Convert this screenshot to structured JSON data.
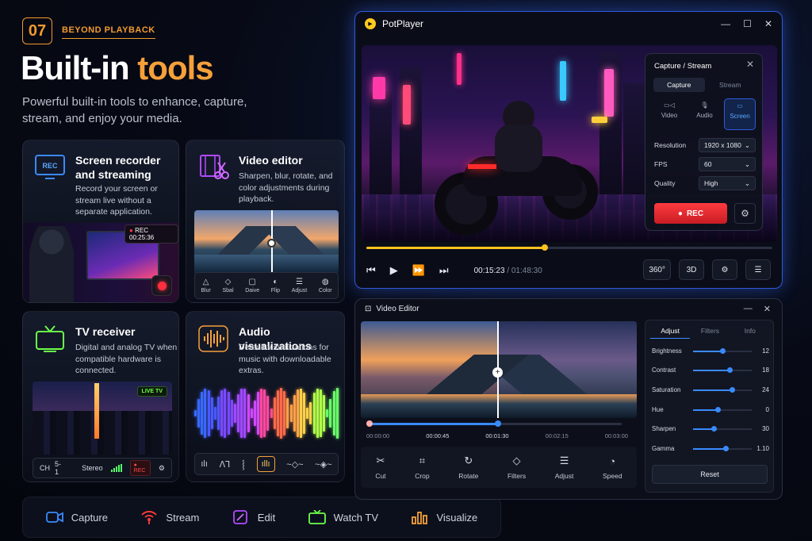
{
  "header": {
    "number": "07",
    "kicker": "BEYOND PLAYBACK",
    "title_main": "Built-in",
    "title_accent": "tools",
    "subtitle": "Powerful built-in tools to enhance, capture, stream, and enjoy your media."
  },
  "cards": {
    "recorder": {
      "icon_label": "REC",
      "title": "Screen recorder and streaming",
      "desc": "Record your screen or stream live without a separate application.",
      "badge": "REC 00:25:36"
    },
    "editor": {
      "title": "Video editor",
      "desc": "Sharpen, blur, rotate, and color adjustments during playback.",
      "tools": [
        "Blur",
        "Sbal",
        "Daive",
        "Flip",
        "Adjust",
        "Color"
      ]
    },
    "tv": {
      "title": "TV receiver",
      "desc": "Digital and analog TV when compatible hardware is connected.",
      "live": "LIVE TV",
      "channel": "CH",
      "channel_num": "5-1",
      "audio": "Stereo",
      "rec": "REC"
    },
    "audio": {
      "title": "Audio visualizations",
      "desc": "Default visualizations for music with downloadable extras."
    }
  },
  "bottom_bar": [
    {
      "label": "Capture",
      "icon": "camera-icon",
      "color": "#3a8aff"
    },
    {
      "label": "Stream",
      "icon": "broadcast-icon",
      "color": "#ff3b3b"
    },
    {
      "label": "Edit",
      "icon": "magic-wand-icon",
      "color": "#b04aff"
    },
    {
      "label": "Watch TV",
      "icon": "tv-icon",
      "color": "#6cff4a"
    },
    {
      "label": "Visualize",
      "icon": "bars-icon",
      "color": "#f5a03a"
    }
  ],
  "player": {
    "title": "PotPlayer",
    "window_controls": [
      "—",
      "☐",
      "✕"
    ],
    "progress": 0.44,
    "time_current": "00:15:23",
    "time_total": "/ 01:48:30",
    "right_buttons": [
      "360°",
      "3D"
    ],
    "capture_panel": {
      "title": "Capture / Stream",
      "tabs": [
        "Capture",
        "Stream"
      ],
      "modes": [
        "Video",
        "Audio",
        "Screen"
      ],
      "resolution_label": "Resolution",
      "resolution_value": "1920 x 1080",
      "fps_label": "FPS",
      "fps_value": "60",
      "quality_label": "Quality",
      "quality_value": "High",
      "rec_label": "REC"
    }
  },
  "editor_window": {
    "title": "Video Editor",
    "times": [
      "00:00:00",
      "00:00:45",
      "00:01:30",
      "00:02:15",
      "00:03:00"
    ],
    "tools": [
      "Cut",
      "Crop",
      "Rotate",
      "Filters",
      "Adjust",
      "Speed"
    ],
    "tabs": [
      "Adjust",
      "Filters",
      "Info"
    ],
    "sliders": [
      {
        "label": "Brightness",
        "value": "12",
        "level": 0.5
      },
      {
        "label": "Contrast",
        "value": "18",
        "level": 0.62
      },
      {
        "label": "Saturation",
        "value": "24",
        "level": 0.66
      },
      {
        "label": "Hue",
        "value": "0",
        "level": 0.42
      },
      {
        "label": "Sharpen",
        "value": "30",
        "level": 0.35
      },
      {
        "label": "Gamma",
        "value": "1.10",
        "level": 0.55
      }
    ],
    "reset_label": "Reset"
  }
}
